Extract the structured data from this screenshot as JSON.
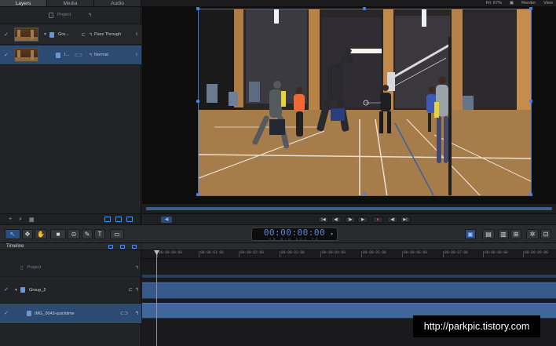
{
  "tabs": [
    {
      "label": "Layers",
      "active": true
    },
    {
      "label": "Media",
      "active": false
    },
    {
      "label": "Audio",
      "active": false
    }
  ],
  "layers_panel": {
    "project_label": "Project",
    "rows": [
      {
        "name": "Gro...",
        "mode": "Pass Through",
        "selected": false
      },
      {
        "name": "I...",
        "mode": "Normal",
        "selected": true
      }
    ]
  },
  "canvas": {
    "fit_label": "Fit: 67%",
    "render_label": "Render",
    "view_label": "View"
  },
  "timecode": {
    "value": "00:00:00:00",
    "units": "HR MIN SEC FR"
  },
  "timeline": {
    "header": "Timeline",
    "rows": [
      {
        "name": "Project"
      },
      {
        "name": "Group_2"
      },
      {
        "name": "IMG_0043-quicktime"
      }
    ],
    "ruler": [
      "00:00:00:00",
      "00:00:01:00",
      "00:00:02:00",
      "00:00:03:00",
      "00:00:04:00",
      "00:00:05:00",
      "00:00:06:00",
      "00:00:07:00",
      "00:00:08:00",
      "00:00:09:00"
    ]
  },
  "watermark": "http://parkpic.tistory.com",
  "colors": {
    "accent": "#3f80ff",
    "clip": "#36598a",
    "selected_row": "#2c4a72"
  }
}
